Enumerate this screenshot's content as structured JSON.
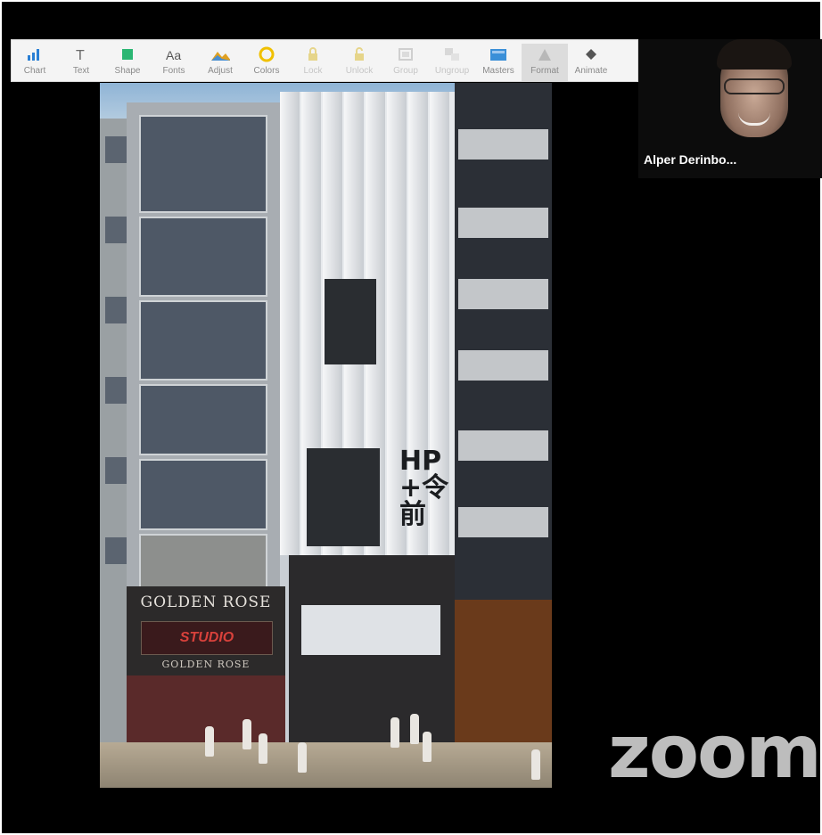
{
  "toolbar": {
    "items": [
      {
        "label": "Chart",
        "icon": "chart-icon",
        "enabled": true
      },
      {
        "label": "Text",
        "icon": "text-icon",
        "enabled": true
      },
      {
        "label": "Shape",
        "icon": "shape-icon",
        "enabled": true
      },
      {
        "label": "Fonts",
        "icon": "fonts-icon",
        "enabled": true
      },
      {
        "label": "Adjust",
        "icon": "adjust-icon",
        "enabled": true
      },
      {
        "label": "Colors",
        "icon": "colors-icon",
        "enabled": true
      },
      {
        "label": "Lock",
        "icon": "lock-icon",
        "enabled": false
      },
      {
        "label": "Unlock",
        "icon": "unlock-icon",
        "enabled": false
      },
      {
        "label": "Group",
        "icon": "group-icon",
        "enabled": false
      },
      {
        "label": "Ungroup",
        "icon": "ungroup-icon",
        "enabled": false
      },
      {
        "label": "Masters",
        "icon": "masters-icon",
        "enabled": true
      },
      {
        "label": "Format",
        "icon": "format-icon",
        "enabled": true,
        "selected": true
      },
      {
        "label": "Animate",
        "icon": "animate-icon",
        "enabled": true
      }
    ],
    "colors": {
      "chart": "#2a7fd4",
      "shape": "#2bb673",
      "adjust": "#e0a020",
      "colors": "#f0c000",
      "masters": "#3a8fd8"
    }
  },
  "slide": {
    "signs": {
      "golden_rose_top": "GOLDEN ROSE",
      "studio": "STUDIO",
      "golden_rose_bottom": "GOLDEN ROSE",
      "facade_glyphs": "HP\n+令\n前"
    }
  },
  "participant": {
    "name": "Alper Derinbo..."
  },
  "watermark": {
    "logo": "zoom"
  }
}
